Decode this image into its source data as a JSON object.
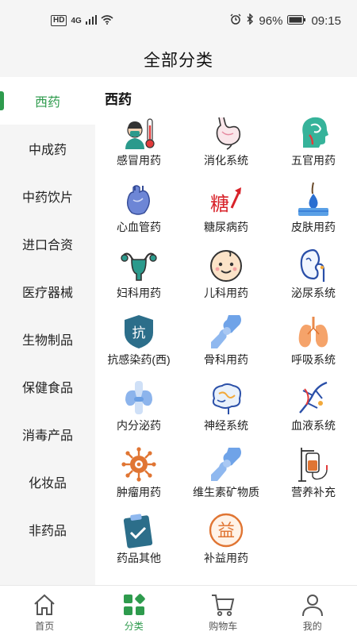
{
  "status": {
    "net_tag": "HD",
    "net_gen": "4G",
    "battery": "96%",
    "time": "09:15"
  },
  "header": {
    "title": "全部分类"
  },
  "sidebar": {
    "items": [
      {
        "label": "西药"
      },
      {
        "label": "中成药"
      },
      {
        "label": "中药饮片"
      },
      {
        "label": "进口合资"
      },
      {
        "label": "医疗器械"
      },
      {
        "label": "生物制品"
      },
      {
        "label": "保健食品"
      },
      {
        "label": "消毒产品"
      },
      {
        "label": "化妆品"
      },
      {
        "label": "非药品"
      }
    ]
  },
  "main": {
    "section_title": "西药",
    "categories": [
      {
        "label": "感冒用药",
        "icon": "cold-medicine-icon"
      },
      {
        "label": "消化系统",
        "icon": "stomach-icon"
      },
      {
        "label": "五官用药",
        "icon": "ent-head-icon"
      },
      {
        "label": "心血管药",
        "icon": "heart-icon"
      },
      {
        "label": "糖尿病药",
        "icon": "diabetes-icon",
        "glyph": "糖"
      },
      {
        "label": "皮肤用药",
        "icon": "skin-icon"
      },
      {
        "label": "妇科用药",
        "icon": "uterus-icon"
      },
      {
        "label": "儿科用药",
        "icon": "baby-face-icon"
      },
      {
        "label": "泌尿系统",
        "icon": "kidney-icon"
      },
      {
        "label": "抗感染药(西)",
        "icon": "anti-infection-shield-icon",
        "glyph": "抗"
      },
      {
        "label": "骨科用药",
        "icon": "bone-joint-icon"
      },
      {
        "label": "呼吸系统",
        "icon": "lungs-icon"
      },
      {
        "label": "内分泌药",
        "icon": "thyroid-icon"
      },
      {
        "label": "神经系统",
        "icon": "brain-icon"
      },
      {
        "label": "血液系统",
        "icon": "blood-vessel-icon"
      },
      {
        "label": "肿瘤用药",
        "icon": "virus-cell-icon"
      },
      {
        "label": "维生素矿物质",
        "icon": "bone-joint-icon-2"
      },
      {
        "label": "营养补充",
        "icon": "iv-drip-icon"
      },
      {
        "label": "药品其他",
        "icon": "clipboard-check-icon"
      },
      {
        "label": "补益用药",
        "icon": "tonic-seal-icon",
        "glyph": "益"
      }
    ]
  },
  "tabbar": {
    "tabs": [
      {
        "label": "首页",
        "icon": "home-icon"
      },
      {
        "label": "分类",
        "icon": "category-grid-icon"
      },
      {
        "label": "购物车",
        "icon": "cart-icon"
      },
      {
        "label": "我的",
        "icon": "user-icon"
      }
    ]
  },
  "colors": {
    "accent": "#2e9b4d",
    "sidebar_bg": "#f5f5f5"
  }
}
